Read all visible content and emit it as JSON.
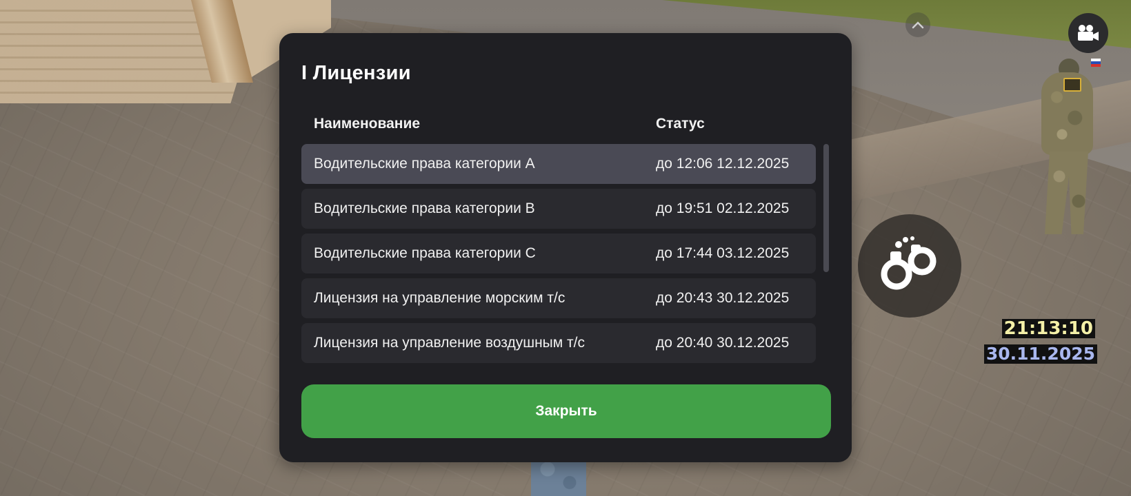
{
  "dialog": {
    "title": "I Лицензии",
    "columns": {
      "name": "Наименование",
      "status": "Статус"
    },
    "rows": [
      {
        "name": "Водительские права категории A",
        "status": "до 12:06 12.12.2025"
      },
      {
        "name": "Водительские права категории B",
        "status": "до 19:51 02.12.2025"
      },
      {
        "name": "Водительские права категории C",
        "status": "до 17:44 03.12.2025"
      },
      {
        "name": "Лицензия на управление морским т/с",
        "status": "до 20:43 30.12.2025"
      },
      {
        "name": "Лицензия на управление воздушным т/с",
        "status": "до 20:40 30.12.2025"
      }
    ],
    "close_label": "Закрыть"
  },
  "hud": {
    "time": "21:13:10",
    "date": "30.11.2025",
    "icons": {
      "camera": "video-camera-icon",
      "cuffs": "handcuffs-icon",
      "up": "chevron-up-icon"
    }
  },
  "colors": {
    "panel": "#1f1f23",
    "row": "#2a2a2f",
    "row_active": "#4a4a55",
    "close_button": "#42a148"
  }
}
